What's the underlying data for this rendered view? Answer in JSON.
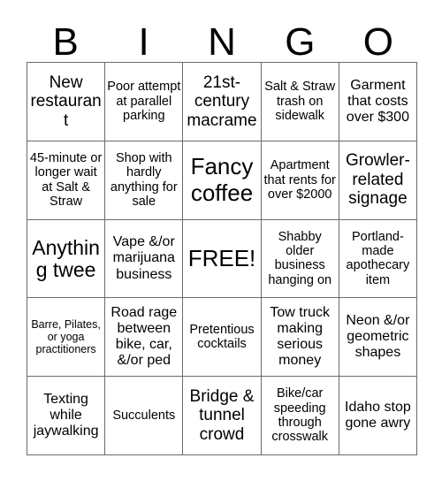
{
  "card": {
    "header_letters": [
      "B",
      "I",
      "N",
      "G",
      "O"
    ],
    "columns": 5,
    "rows": 5,
    "border_color": "#6b6b6b",
    "background_color": "#ffffff",
    "text_color": "#000000",
    "cells": [
      [
        {
          "text": "New restaurant",
          "size": "l",
          "free": false
        },
        {
          "text": "Poor attempt at parallel parking",
          "size": "s",
          "free": false
        },
        {
          "text": "21st-century macrame",
          "size": "l",
          "free": false
        },
        {
          "text": "Salt & Straw trash on sidewalk",
          "size": "s",
          "free": false
        },
        {
          "text": "Garment that costs over $300",
          "size": "m",
          "free": false
        }
      ],
      [
        {
          "text": "45-minute or longer wait at Salt & Straw",
          "size": "s",
          "free": false
        },
        {
          "text": "Shop with hardly anything for sale",
          "size": "s",
          "free": false
        },
        {
          "text": "Fancy coffee",
          "size": "xxl",
          "free": false
        },
        {
          "text": "Apartment that rents for over $2000",
          "size": "s",
          "free": false
        },
        {
          "text": "Growler-related signage",
          "size": "l",
          "free": false
        }
      ],
      [
        {
          "text": "Anything twee",
          "size": "xl",
          "free": false
        },
        {
          "text": "Vape &/or marijuana business",
          "size": "m",
          "free": false
        },
        {
          "text": "FREE!",
          "size": "xxl",
          "free": true
        },
        {
          "text": "Shabby older business hanging on",
          "size": "s",
          "free": false
        },
        {
          "text": "Portland-made apothecary item",
          "size": "s",
          "free": false
        }
      ],
      [
        {
          "text": "Barre, Pilates, or yoga practitioners",
          "size": "xs",
          "free": false
        },
        {
          "text": "Road rage between bike, car, &/or ped",
          "size": "m",
          "free": false
        },
        {
          "text": "Pretentious cocktails",
          "size": "s",
          "free": false
        },
        {
          "text": "Tow truck making serious money",
          "size": "m",
          "free": false
        },
        {
          "text": "Neon &/or geometric shapes",
          "size": "m",
          "free": false
        }
      ],
      [
        {
          "text": "Texting while jaywalking",
          "size": "m",
          "free": false
        },
        {
          "text": "Succulents",
          "size": "s",
          "free": false
        },
        {
          "text": "Bridge & tunnel crowd",
          "size": "l",
          "free": false
        },
        {
          "text": "Bike/car speeding through crosswalk",
          "size": "s",
          "free": false
        },
        {
          "text": "Idaho stop gone awry",
          "size": "m",
          "free": false
        }
      ]
    ]
  }
}
